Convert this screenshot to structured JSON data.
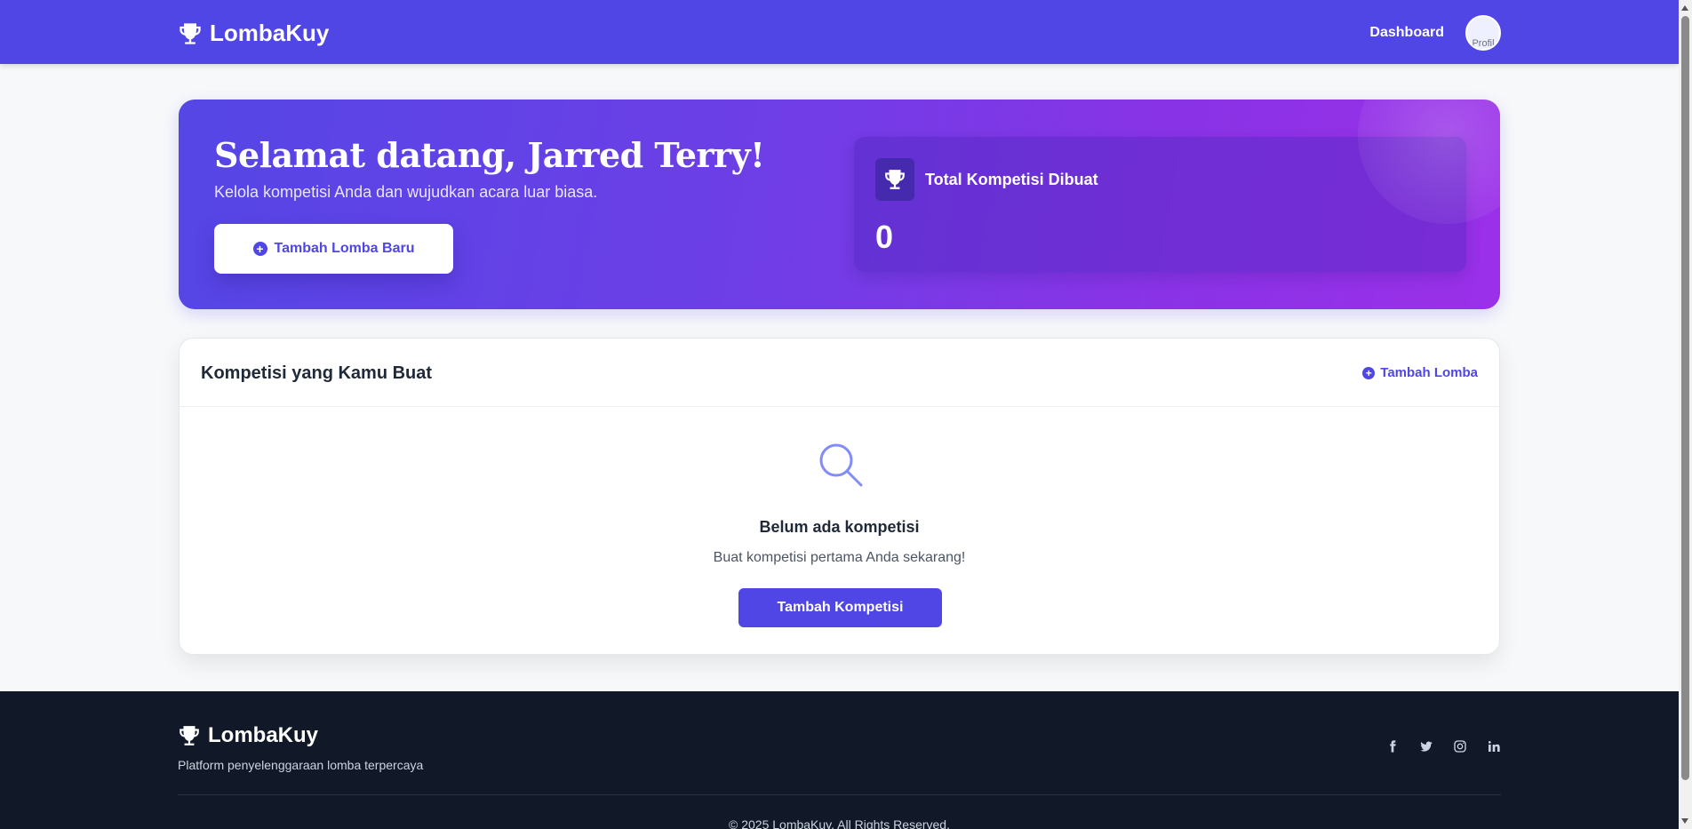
{
  "navbar": {
    "brand": "LombaKuy",
    "links": [
      {
        "label": "Dashboard"
      }
    ],
    "avatar_alt": "Profil"
  },
  "hero": {
    "title": "Selamat datang, Jarred Terry!",
    "subtitle": "Kelola kompetisi Anda dan wujudkan acara luar biasa.",
    "button_label": "Tambah Lomba Baru",
    "stat": {
      "label": "Total Kompetisi Dibuat",
      "value": "0"
    }
  },
  "competitions": {
    "title": "Kompetisi yang Kamu Buat",
    "add_link": "Tambah Lomba",
    "empty": {
      "title": "Belum ada kompetisi",
      "subtitle": "Buat kompetisi pertama Anda sekarang!",
      "button_label": "Tambah Kompetisi"
    }
  },
  "footer": {
    "brand": "LombaKuy",
    "tagline": "Platform penyelenggaraan lomba terpercaya",
    "socials": [
      "facebook-icon",
      "twitter-icon",
      "instagram-icon",
      "linkedin-icon"
    ],
    "copyright": "© 2025 LombaKuy. All Rights Reserved."
  },
  "colors": {
    "primary": "#4f46e5",
    "hero_end": "#9b30e9",
    "footer_bg": "#111827"
  }
}
